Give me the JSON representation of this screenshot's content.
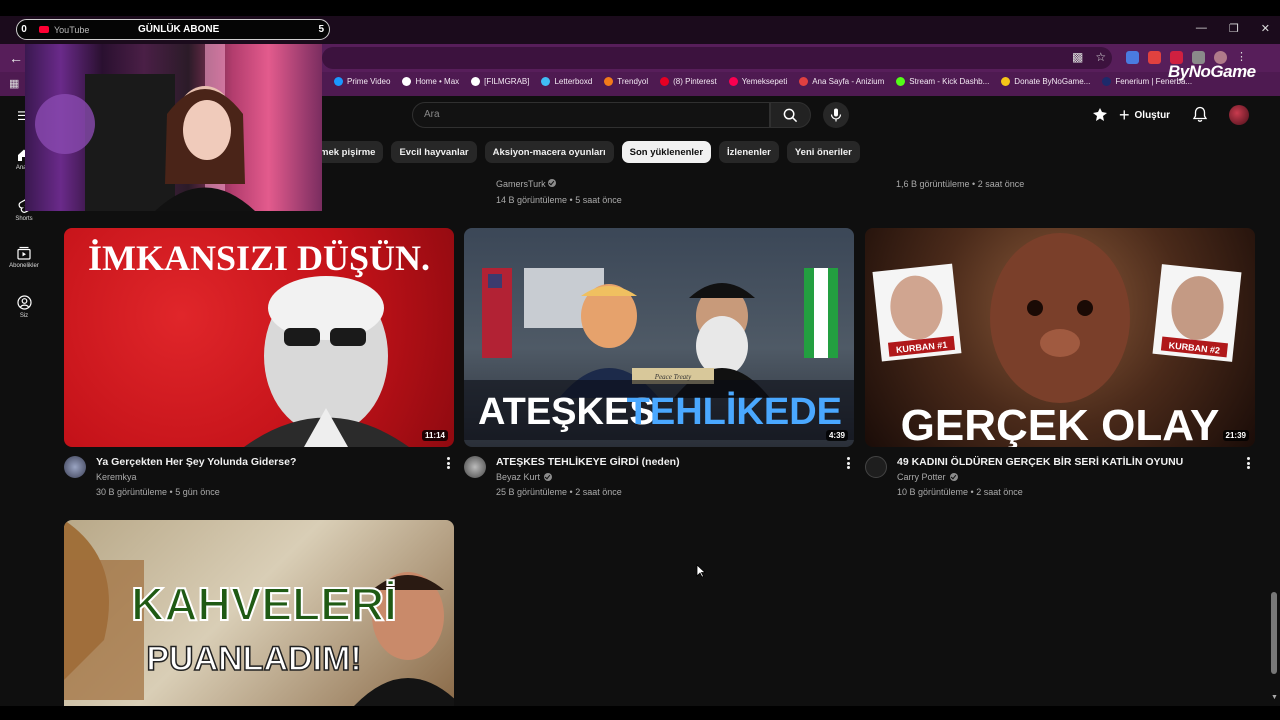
{
  "browser": {
    "tab_title": "YouTube",
    "overlay_goal": {
      "left_count": "0",
      "label": "GÜNLÜK ABONE",
      "right_count": "5"
    },
    "bookmarks": [
      {
        "label": "Prime Video",
        "color": "#1a98ff"
      },
      {
        "label": "Home • Max",
        "color": "#ffffff"
      },
      {
        "label": "[FILMGRAB]",
        "color": "#ffffff"
      },
      {
        "label": "Letterboxd",
        "color": "#40bcf4"
      },
      {
        "label": "Trendyol",
        "color": "#f27a1a"
      },
      {
        "label": "(8) Pinterest",
        "color": "#e60023"
      },
      {
        "label": "Yemeksepeti",
        "color": "#fa0050"
      },
      {
        "label": "Ana Sayfa - Anizium",
        "color": "#e04040"
      },
      {
        "label": "Stream - Kick Dashb...",
        "color": "#53fc18"
      },
      {
        "label": "Donate ByNoGame...",
        "color": "#f5c518"
      },
      {
        "label": "Fenerium | Fenerba...",
        "color": "#1c2a6b"
      }
    ],
    "bynogame_logo": "ByNoGame"
  },
  "header": {
    "search_placeholder": "Ara",
    "create_label": "Oluştur"
  },
  "sidebar": {
    "items": [
      {
        "label": "Ana S"
      },
      {
        "label": "Shorts"
      },
      {
        "label": "Abonelikler"
      },
      {
        "label": "Siz"
      }
    ]
  },
  "chips": [
    {
      "label": "mek pişirme",
      "active": false
    },
    {
      "label": "Evcil hayvanlar",
      "active": false
    },
    {
      "label": "Aksiyon-macera oyunları",
      "active": false
    },
    {
      "label": "Son yüklenenler",
      "active": true
    },
    {
      "label": "İzlenenler",
      "active": false
    },
    {
      "label": "Yeni öneriler",
      "active": false
    }
  ],
  "previous_row": [
    {
      "channel": "GamersTurk",
      "stats": "14 B görüntüleme • 5 saat önce"
    },
    {
      "channel": "",
      "stats": "1,6 B görüntüleme • 2 saat önce"
    }
  ],
  "videos": [
    {
      "thumb_text": "İMKANSIZI DÜŞÜN.",
      "duration": "11:14",
      "title": "Ya Gerçekten Her Şey Yolunda Giderse?",
      "channel": "Keremkya",
      "verified": false,
      "stats": "30 B görüntüleme • 5 gün önce"
    },
    {
      "thumb_text_a": "ATEŞKES",
      "thumb_text_b": "TEHLİKEDE",
      "thumb_small": "Peace Treaty",
      "duration": "4:39",
      "title": "ATEŞKES TEHLİKEYE GİRDİ (neden)",
      "channel": "Beyaz Kurt",
      "verified": true,
      "stats": "25 B görüntüleme • 2 saat önce"
    },
    {
      "thumb_text": "GERÇEK OLAY",
      "label_a": "KURBAN #1",
      "label_b": "KURBAN #2",
      "duration": "21:39",
      "title": "49 KADINI ÖLDÜREN GERÇEK BİR SERİ KATİLİN OYUNU",
      "channel": "Carry Potter",
      "verified": true,
      "stats": "10 B görüntüleme • 2 saat önce"
    },
    {
      "thumb_text_a": "KAHVELERİ",
      "thumb_text_b": "PUANLADIM!"
    }
  ],
  "colors": {
    "background": "#0f0f0f",
    "chrome": "#571e5a",
    "accent_red": "#ff0033"
  }
}
